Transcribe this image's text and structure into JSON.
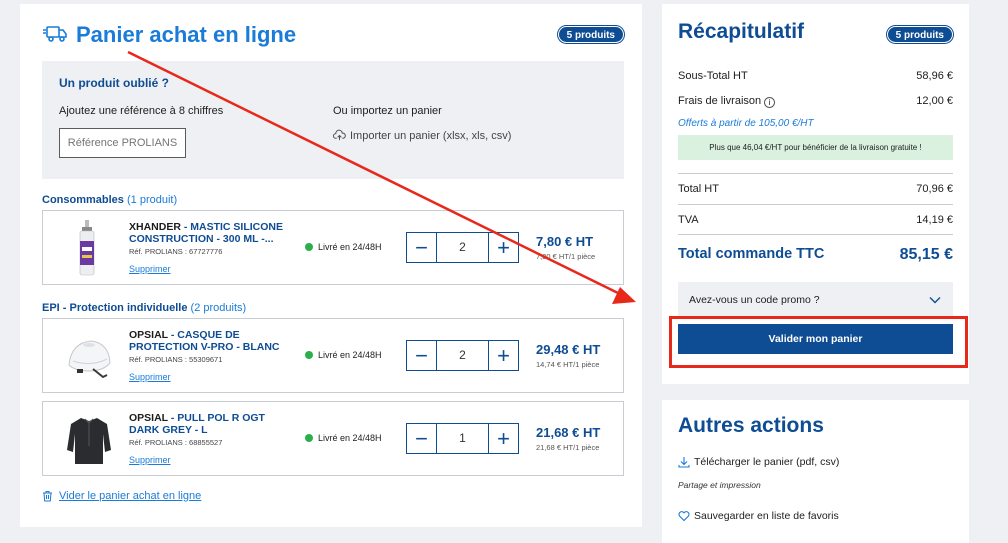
{
  "cart": {
    "title": "Panier achat en ligne",
    "badge": "5 produits",
    "forgot": {
      "title": "Un produit oublié ?",
      "ref_label": "Ajoutez une référence à 8 chiffres",
      "ref_placeholder": "Référence PROLIANS",
      "import_label": "Ou importez un panier",
      "import_link": "Importer un panier (xlsx, xls, csv)"
    },
    "categories": [
      {
        "name": "Consommables",
        "count": "(1 produit)"
      },
      {
        "name": "EPI - Protection individuelle",
        "count": "(2 produits)"
      }
    ],
    "products": [
      {
        "brand": "XHANDER",
        "name": "MASTIC SILICONE CONSTRUCTION - 300 ML -...",
        "ref": "Réf. PROLIANS : 67727776",
        "delete": "Supprimer",
        "stock": "Livré en 24/48H",
        "qty": "2",
        "price": "7,80 € HT",
        "unit": "7,80 € HT/1 pièce",
        "image": "silicone-cartridge"
      },
      {
        "brand": "OPSIAL",
        "name": "CASQUE DE PROTECTION V-PRO - BLANC",
        "ref": "Réf. PROLIANS : 55309671",
        "delete": "Supprimer",
        "stock": "Livré en 24/48H",
        "qty": "2",
        "price": "29,48 € HT",
        "unit": "14,74 € HT/1 pièce",
        "image": "white-helmet"
      },
      {
        "brand": "OPSIAL",
        "name": "PULL POL R OGT DARK GREY - L",
        "ref": "Réf. PROLIANS : 68855527",
        "delete": "Supprimer",
        "stock": "Livré en 24/48H",
        "qty": "1",
        "price": "21,68 € HT",
        "unit": "21,68 € HT/1 pièce",
        "image": "dark-pullover"
      }
    ],
    "empty_link": "Vider le panier achat en ligne"
  },
  "summary": {
    "title": "Récapitulatif",
    "badge": "5 produits",
    "subtotal_label": "Sous-Total HT",
    "subtotal_value": "58,96 €",
    "shipping_label": "Frais de livraison",
    "shipping_value": "12,00 €",
    "free_note": "Offerts à partir de 105,00 €/HT",
    "green_note": "Plus que 46,04 €/HT pour bénéficier de la livraison gratuite !",
    "total_ht_label": "Total HT",
    "total_ht_value": "70,96 €",
    "tva_label": "TVA",
    "tva_value": "14,19 €",
    "total_ttc_label": "Total commande TTC",
    "total_ttc_value": "85,15 €",
    "promo_label": "Avez-vous un code promo ?",
    "validate_label": "Valider mon panier"
  },
  "other_actions": {
    "title": "Autres actions",
    "download": "Télécharger le panier (pdf, csv)",
    "share": "Partage et impression",
    "favorites": "Sauvegarder en liste de favoris"
  },
  "colors": {
    "primary": "#0e4c93",
    "link": "#1a7bd8",
    "stock": "#2ab04b",
    "annotation": "#e8281b"
  }
}
